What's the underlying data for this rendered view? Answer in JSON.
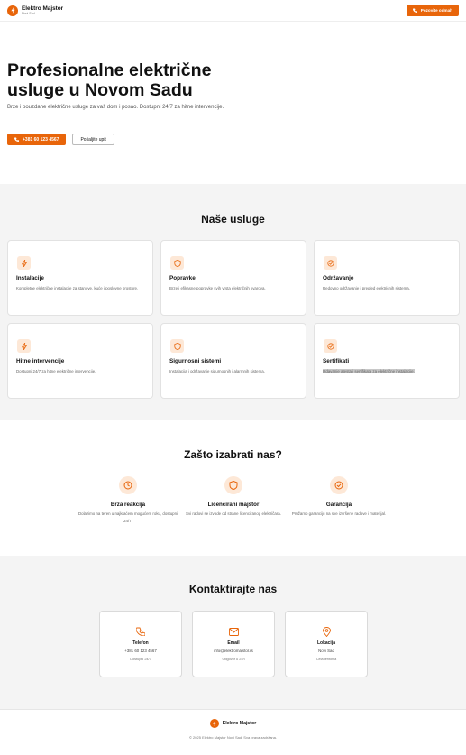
{
  "brand": {
    "name": "Elektro Majstor",
    "city": "Novi Sad"
  },
  "header": {
    "cta_label": "Pozovite odmah"
  },
  "hero": {
    "title": "Profesionalne električne usluge u Novom Sadu",
    "description": "Brze i pouzdane električne usluge za vaš dom i posao. Dostupni 24/7 za hitne intervencije.",
    "phone_label": "+381 60 123 4567",
    "secondary_label": "Pošaljite upit"
  },
  "services": {
    "title": "Naše usluge",
    "items": [
      {
        "icon": "bolt-icon",
        "title": "Instalacije",
        "description": "Kompletne električne instalacije za stanove, kuće i poslovne prostore."
      },
      {
        "icon": "shield-icon",
        "title": "Popravke",
        "description": "Brze i efikasne popravke svih vrsta električnih kvarova."
      },
      {
        "icon": "check-circle-icon",
        "title": "Održavanje",
        "description": "Redovno održavanje i pregled električnih sistema."
      },
      {
        "icon": "bolt-icon",
        "title": "Hitne intervencije",
        "description": "Dostupni 24/7 za hitne električne intervencije."
      },
      {
        "icon": "shield-icon",
        "title": "Sigurnosni sistemi",
        "description": "Instalacija i održavanje sigurnosnih i alarmnih sistema."
      },
      {
        "icon": "check-circle-icon",
        "title": "Sertifikati",
        "description": "Izdavanje atesta i sertifikata za električne instalacije."
      }
    ]
  },
  "why": {
    "title": "Zašto izabrati nas?",
    "items": [
      {
        "icon": "clock-icon",
        "title": "Brza reakcija",
        "description": "Dolazimo na teren u najkraćem mogućem roku, dostupni 24/7."
      },
      {
        "icon": "shield-icon",
        "title": "Licencirani majstor",
        "description": "Svi radovi se izvode od strane licenciranog električara."
      },
      {
        "icon": "check-circle-icon",
        "title": "Garancija",
        "description": "Pružamo garanciju na sve izvršene radove i materijal."
      }
    ]
  },
  "contact": {
    "title": "Kontaktirajte nas",
    "items": [
      {
        "icon": "phone-icon",
        "title": "Telefon",
        "value": "+381 60 123 4567",
        "note": "Dostupni 24/7"
      },
      {
        "icon": "mail-icon",
        "title": "Email",
        "value": "info@elektromajstor.rs",
        "note": "Odgovor u 24h"
      },
      {
        "icon": "location-pin-icon",
        "title": "Lokacija",
        "value": "Novi Sad",
        "note": "Cela teritorija"
      }
    ]
  },
  "footer": {
    "copyright": "© 2025 Elektro Majstor Novi Sad. Sva prava zadržana."
  },
  "colors": {
    "accent": "#e8650a",
    "accent_soft": "#fde8d7"
  }
}
